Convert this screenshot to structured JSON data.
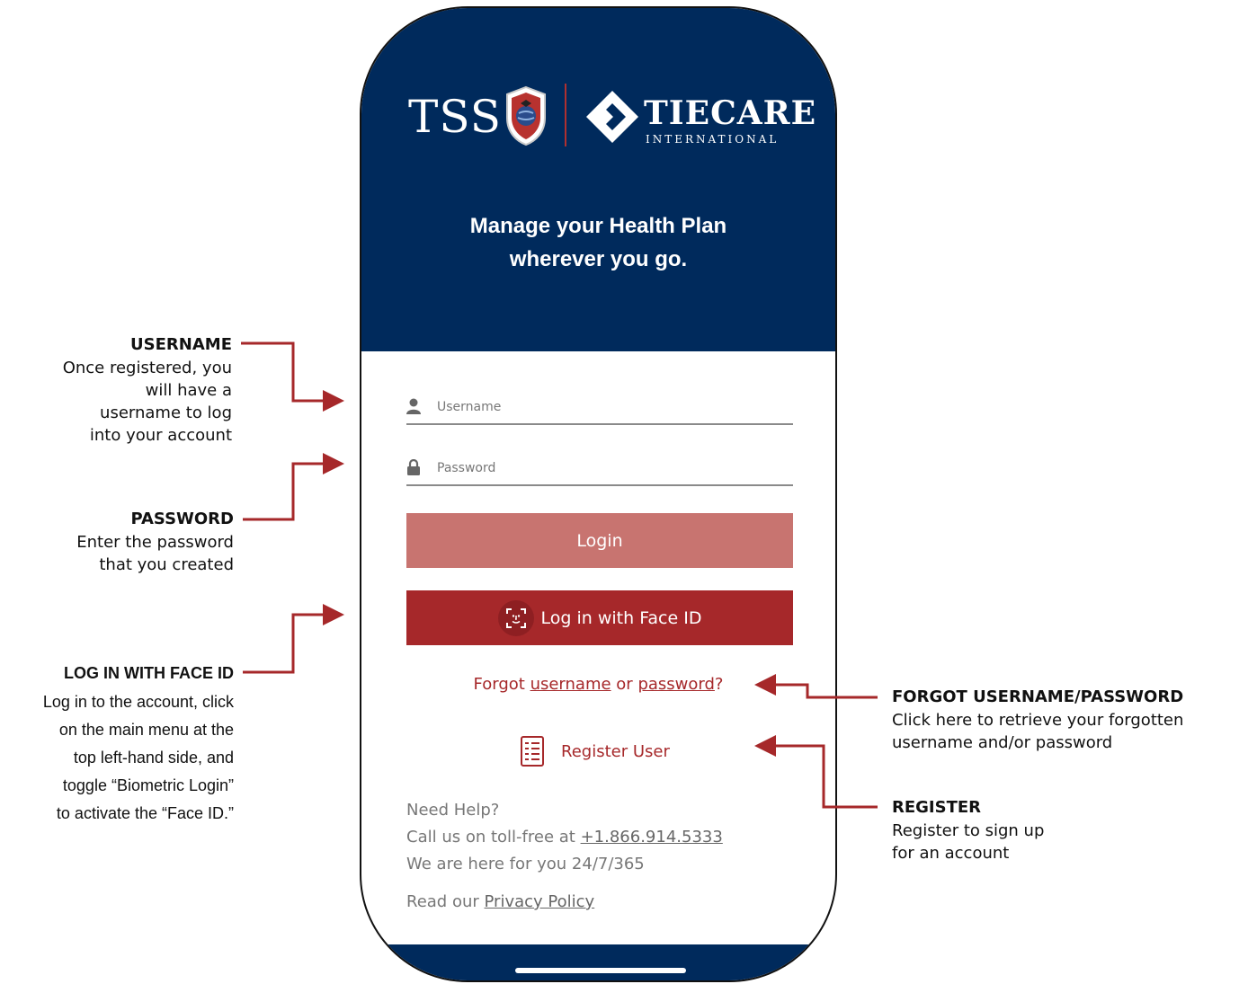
{
  "app": {
    "logo_tss": "TSS",
    "logo_tiecare": "TIECARE",
    "logo_tiecare_sub": "INTERNATIONAL",
    "tagline_line1": "Manage your Health Plan",
    "tagline_line2": "wherever you go.",
    "username_placeholder": "Username",
    "password_placeholder": "Password",
    "login_label": "Login",
    "face_id_label": "Log in with Face ID",
    "forgot_prefix": "Forgot",
    "forgot_username": "username",
    "forgot_or": "or",
    "forgot_password": "password",
    "forgot_suffix": "?",
    "register_label": "Register User",
    "help_title": "Need Help?",
    "help_call_prefix": "Call us on toll-free at",
    "help_phone": "+1.866.914.5333",
    "help_availability": "We are here for you 24/7/365",
    "privacy_prefix": "Read our",
    "privacy_link": "Privacy Policy"
  },
  "annotations": {
    "username": {
      "title": "USERNAME",
      "lines": [
        "Once registered, you",
        "will have a",
        "username to log",
        "into your account"
      ]
    },
    "password": {
      "title": "PASSWORD",
      "lines": [
        "Enter the password",
        "that you created"
      ]
    },
    "face_id": {
      "title": "LOG IN WITH FACE ID",
      "lines": [
        "Log in to the account, click",
        "on the main menu at the",
        "top left-hand side, and",
        "toggle “Biometric Login”",
        "to activate the “Face ID.”"
      ]
    },
    "forgot": {
      "title": "FORGOT USERNAME/PASSWORD",
      "lines": [
        "Click here to retrieve your forgotten",
        "username and/or password"
      ]
    },
    "register": {
      "title": "REGISTER",
      "lines": [
        "Register to sign up",
        "for an account"
      ]
    }
  },
  "colors": {
    "navy": "#002a5c",
    "brand_red": "#a6282a",
    "login_disabled": "#c87470",
    "callout_line": "#a6282a"
  }
}
